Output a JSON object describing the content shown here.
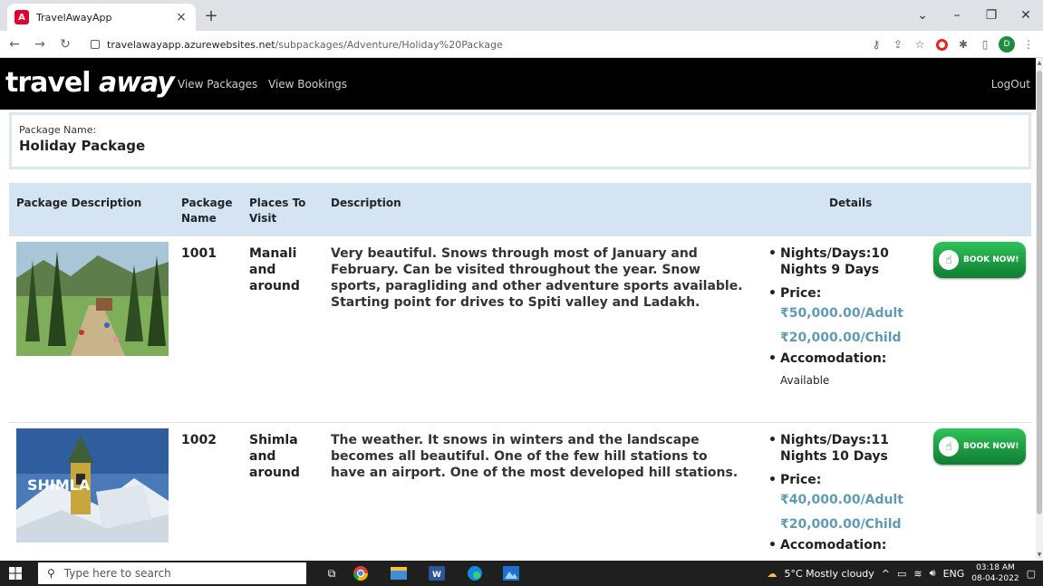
{
  "browser": {
    "tab_title": "TravelAwayApp",
    "favicon_letter": "A",
    "url_domain": "travelawayapp.azurewebsites.net",
    "url_path": "/subpackages/Adventure/Holiday%20Package",
    "profile_initial": "D"
  },
  "app": {
    "brand_first": "travel",
    "brand_second": "away",
    "nav": [
      "View Packages",
      "View Bookings"
    ],
    "logout": "LogOut"
  },
  "package": {
    "label": "Package Name:",
    "value": "Holiday Package"
  },
  "table": {
    "headers": {
      "package_description": "Package Description",
      "package_name": "Package Name",
      "places": "Places To Visit",
      "description": "Description",
      "details": "Details"
    },
    "rows": [
      {
        "package_name": "1001",
        "places": "Manali and around",
        "description": "Very beautiful. Snows through most of January and February. Can be visited throughout the year. Snow sports, paragliding and other adventure sports available. Starting point for drives to Spiti valley and Ladakh.",
        "nights": "Nights/Days:10 Nights 9 Days",
        "price_label": "Price:",
        "price_adult": "₹50,000.00/Adult",
        "price_child": "₹20,000.00/Child",
        "accommodation_label": "Accomodation:",
        "accommodation_value": "Available",
        "book_label": "BOOK NOW!",
        "image_caption": ""
      },
      {
        "package_name": "1002",
        "places": "Shimla and around",
        "description": "The weather. It snows in winters and the landscape becomes all beautiful. One of the few hill stations to have an airport. One of the most developed hill stations.",
        "nights": "Nights/Days:11 Nights 10 Days",
        "price_label": "Price:",
        "price_adult": "₹40,000.00/Adult",
        "price_child": "₹20,000.00/Child",
        "accommodation_label": "Accomodation:",
        "accommodation_value": "",
        "book_label": "BOOK NOW!",
        "image_caption": "SHIMLA"
      }
    ]
  },
  "taskbar": {
    "search_placeholder": "Type here to search",
    "weather": "5°C  Mostly cloudy",
    "lang": "ENG",
    "time": "03:18 AM",
    "date": "08-04-2022"
  },
  "colors": {
    "nav_bg": "#000000",
    "table_header_bg": "#d5e4f2",
    "price_text": "#5f9bb2",
    "book_button": "#1fa348"
  }
}
